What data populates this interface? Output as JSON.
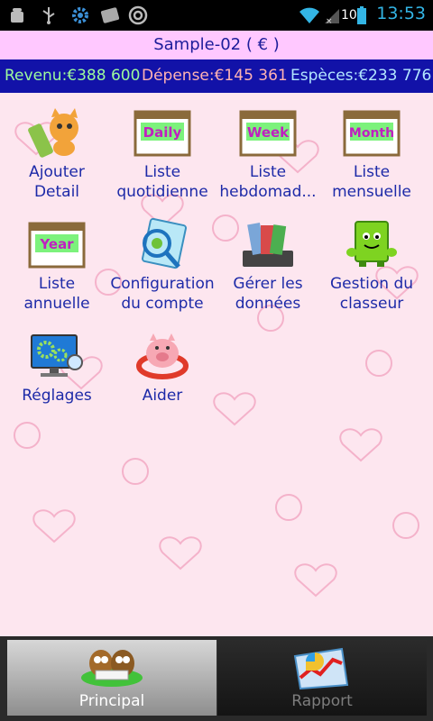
{
  "status_bar": {
    "time": "13:53",
    "battery": "100",
    "icons": [
      "android-debug-icon",
      "usb-icon",
      "gear-icon",
      "sd-card-icon",
      "record-icon",
      "wifi-icon",
      "no-signal-icon",
      "battery-icon"
    ]
  },
  "title": "Sample-02 ( € )",
  "summary": {
    "revenue": "Revenu:€388 600",
    "expense": "Dépense:€145 361",
    "cash": "Espèces:€233 776",
    "colors": {
      "revenue": "#9dfa9d",
      "expense": "#ffb3b3",
      "cash": "#b3e6ff"
    }
  },
  "menu": [
    {
      "label": "Ajouter Detail",
      "icon": "cat-pencil-icon"
    },
    {
      "label": "Liste quotidienne",
      "icon": "calendar-daily-icon",
      "badge": "Daily"
    },
    {
      "label": "Liste hebdomad...",
      "icon": "calendar-week-icon",
      "badge": "Week"
    },
    {
      "label": "Liste mensuelle",
      "icon": "calendar-month-icon",
      "badge": "Month"
    },
    {
      "label": "Liste annuelle",
      "icon": "calendar-year-icon",
      "badge": "Year"
    },
    {
      "label": "Configuration du compte",
      "icon": "account-config-icon"
    },
    {
      "label": "Gérer les données",
      "icon": "data-folders-icon"
    },
    {
      "label": "Gestion du classeur",
      "icon": "green-book-icon"
    },
    {
      "label": "Réglages",
      "icon": "settings-monitor-icon"
    },
    {
      "label": "Aider",
      "icon": "piggy-bank-icon"
    }
  ],
  "tabs": [
    {
      "label": "Principal",
      "icon": "owls-tab-icon",
      "active": true
    },
    {
      "label": "Rapport",
      "icon": "chart-tab-icon",
      "active": false
    }
  ]
}
